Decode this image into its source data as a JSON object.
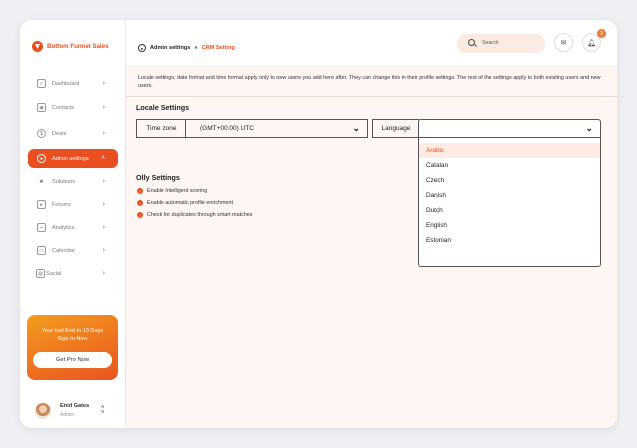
{
  "brand": {
    "name": "Bottom Funnel Sales"
  },
  "sidebar": {
    "items": [
      {
        "label": "Dashboard",
        "icon": "dashboard-icon"
      },
      {
        "label": "Contacts",
        "icon": "contacts-icon"
      },
      {
        "label": "Deals",
        "icon": "deals-icon"
      },
      {
        "label": "Admin settings",
        "icon": "admin-settings-icon",
        "active": true
      },
      {
        "label": "Solutions",
        "icon": "solutions-icon"
      },
      {
        "label": "Forums",
        "icon": "forums-icon"
      },
      {
        "label": "Analytics",
        "icon": "analytics-icon"
      },
      {
        "label": "Calendar",
        "icon": "calendar-icon"
      },
      {
        "label": "Social",
        "icon": "social-icon"
      }
    ],
    "promo": {
      "line1": "Your trail End in 10 Days",
      "line2": "Sign In Now",
      "button": "Get Pro Now"
    },
    "user": {
      "name": "Enid Gates",
      "role": "Admin"
    }
  },
  "header": {
    "breadcrumb": {
      "parent": "Admin settings",
      "separator": "»",
      "current": "CRM Setting"
    },
    "search_placeholder": "Search",
    "notification_count": "2"
  },
  "main": {
    "notice": "Locale settings, date format and time format apply only to new users you add here after. They can change this in their profile settings. The rest of the settings apply to both existing users and new users.",
    "locale_title": "Locale Settings",
    "timezone_label": "Time zone",
    "timezone_value": "(GMT+00:00) UTC",
    "language_label": "Language",
    "language_value": "",
    "language_options": [
      "Arabic",
      "Catalan",
      "Czech",
      "Danish",
      "Dutch",
      "English",
      "Estonian"
    ],
    "language_highlighted": "Arabic",
    "olly_title": "Olly Settings",
    "olly_options": [
      "Enable Intelligent scoring",
      "Enable automatic profile enrichment",
      "Check for duplicates through smart matches"
    ]
  },
  "colors": {
    "accent": "#E8501E",
    "promo_from": "#F39C1E",
    "content_bg": "#FDF6F3"
  }
}
